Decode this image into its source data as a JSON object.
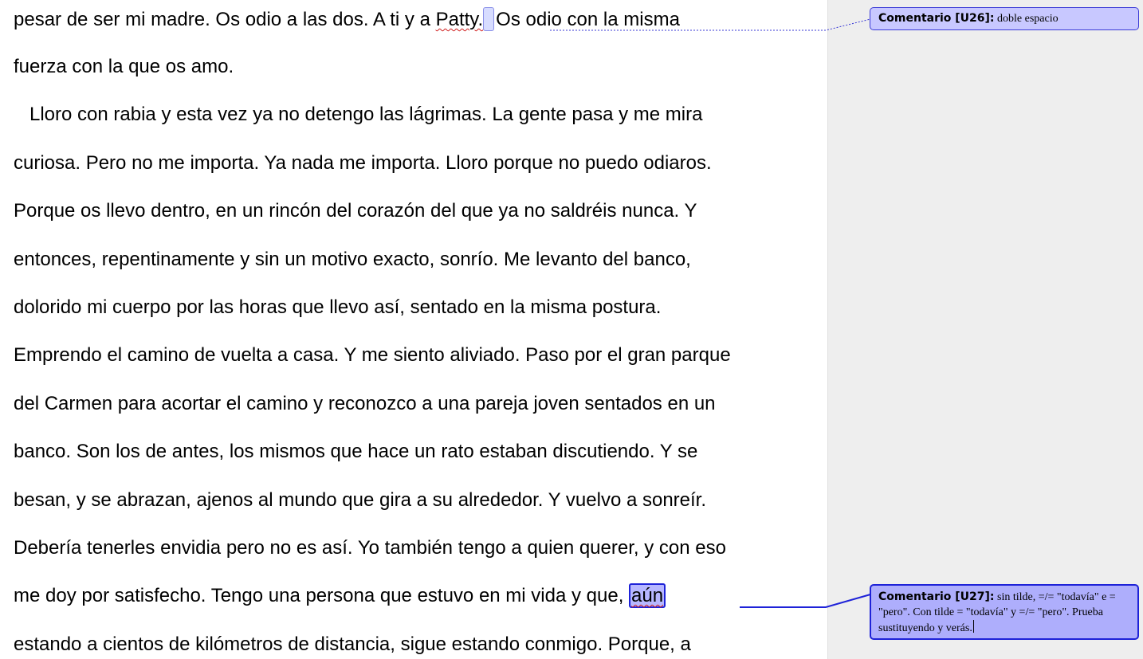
{
  "document": {
    "lines": [
      {
        "pre": "pesar de ser mi madre. Os odio a las dos. A ti y a ",
        "misspelled": "Patty.",
        "post": "Os odio con la misma"
      },
      {
        "text": "fuerza con la que os amo."
      },
      {
        "text": "   Lloro con rabia y esta vez ya no detengo las lágrimas. La gente pasa y me mira"
      },
      {
        "text": "curiosa. Pero no me importa. Ya nada me importa. Lloro porque no puedo odiaros."
      },
      {
        "text": "Porque os llevo dentro, en un rincón del corazón del que ya no saldréis nunca. Y"
      },
      {
        "text": "entonces, repentinamente y sin un motivo exacto, sonrío. Me levanto del banco,"
      },
      {
        "text": "dolorido mi cuerpo por las horas que llevo así, sentado en la misma postura."
      },
      {
        "text": "Emprendo el camino de vuelta a casa. Y me siento aliviado. Paso por el gran parque"
      },
      {
        "text": "del Carmen para acortar el camino y reconozco a una pareja joven sentados en un"
      },
      {
        "text": "banco. Son los de antes, los mismos que hace un rato estaban discutiendo. Y se"
      },
      {
        "text": "besan, y se abrazan, ajenos al mundo que gira a su alrededor. Y vuelvo a sonreír."
      },
      {
        "text": "Debería tenerles envidia pero no es así. Yo también tengo a quien querer, y con eso"
      },
      {
        "pre": "me doy por satisfecho. Tengo una persona que estuvo en mi vida y que, ",
        "anchor": "aún"
      },
      {
        "text": "estando a cientos de kilómetros de distancia, sigue estando conmigo. Porque, a"
      }
    ]
  },
  "comments": [
    {
      "author": "Comentario [U26]:",
      "text": "doble espacio"
    },
    {
      "author": "Comentario [U27]:",
      "text": "sin tilde, =/= \"todavía\" e = \"pero\". Con tilde = \"todavía\" y =/= \"pero\". Prueba sustituyendo y verás."
    }
  ],
  "colors": {
    "comment_fill": "#c8c8ff",
    "comment_active_fill": "#aeaefc",
    "comment_border": "#1e22d8",
    "margin_background": "#eeeeee",
    "spellcheck_underline": "#d02020"
  }
}
